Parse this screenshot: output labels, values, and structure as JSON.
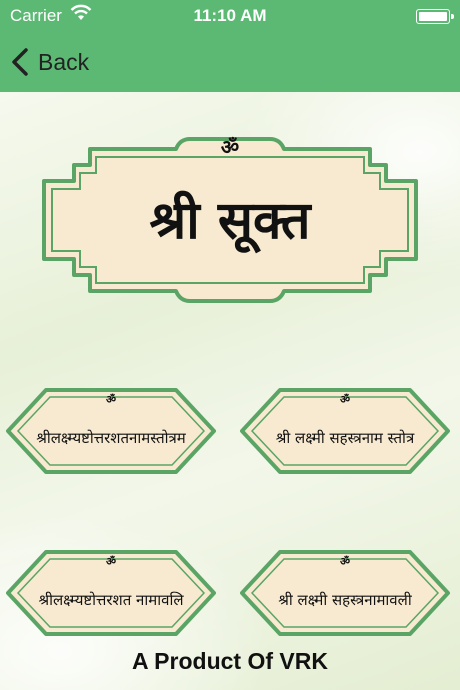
{
  "status_bar": {
    "carrier": "Carrier",
    "time": "11:10 AM"
  },
  "nav": {
    "back_label": "Back"
  },
  "title": {
    "om": "ॐ",
    "text": "श्री सूक्त"
  },
  "buttons": [
    {
      "om": "ॐ",
      "label": "श्रीलक्ष्म्यष्टोत्तरशतनामस्तोत्रम"
    },
    {
      "om": "ॐ",
      "label": "श्री लक्ष्मी सहस्त्रनाम स्तोत्र"
    },
    {
      "om": "ॐ",
      "label": "श्रीलक्ष्म्यष्टोत्तरशत नामावलि"
    },
    {
      "om": "ॐ",
      "label": "श्री लक्ष्मी सहस्त्रनामावली"
    }
  ],
  "footer": {
    "text": "A Product Of VRK"
  },
  "colors": {
    "accent_green": "#5cb974",
    "frame_fill": "#f8ead0",
    "frame_border": "#5aa565"
  }
}
